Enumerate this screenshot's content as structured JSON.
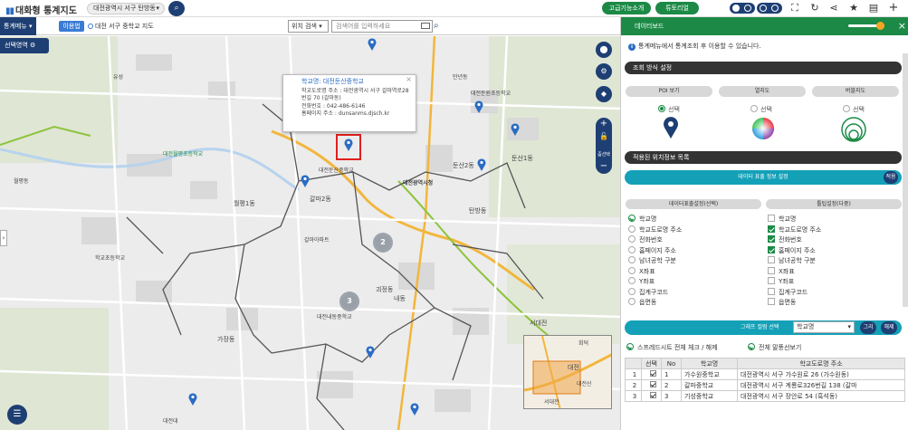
{
  "app": {
    "title": "대화형 통계지도",
    "region": "대전광역시 서구 탄방동"
  },
  "topbar": {
    "advanced": "고급기능소개",
    "tutorial": "튜토리얼"
  },
  "subbar": {
    "menu": "통계메뉴",
    "help": "이용법",
    "breadcrumb": "대전 서구 중학교 지도",
    "search_type": "위치 검색",
    "search_placeholder": "검색어를 입력하세요"
  },
  "map": {
    "select_area": "선택영역",
    "ctrl_labels": {
      "school": "지도",
      "settings": "설정",
      "zoom": "줌선택"
    },
    "popup": {
      "title": "학교명: 대전둔산중학교",
      "lines": [
        "학교도로명 주소 : 대전광역시 서구 갈마역로28번길 70 (갈마동)",
        "전화번호 : 042-486-6146",
        "홈페이지 주소 : dunsanms.djsch.kr"
      ]
    },
    "clusters": [
      "2",
      "3"
    ],
    "labels": [
      "유성",
      "대전월평초등학교",
      "갈마2동",
      "둔산2동",
      "대전광역시청",
      "탄방동",
      "둔산1동",
      "대전둔산중학교",
      "갈마아파트",
      "월평1동",
      "내동",
      "가장동",
      "대전내동중학교",
      "서대전",
      "대전대",
      "학교초등학교",
      "괴정동",
      "만년동",
      "월평동",
      "대전둔원초등학교"
    ],
    "minimap": [
      "회덕",
      "대전",
      "대전신",
      "서대전"
    ]
  },
  "panel": {
    "title": "데이터보드",
    "info": "통계메뉴에서 통계조회 후 이용할 수 있습니다.",
    "sec1": "조회 방식 설정",
    "modes": [
      "POI 보기",
      "열지도",
      "버블지도"
    ],
    "mode_labels": [
      "선택",
      "선택",
      "선택"
    ],
    "sec2": "적용된 위치정보 목록",
    "data_display": "데이터 표출 정보 설정",
    "apply": "적용",
    "subtabs": [
      "데이터표출설정(선택)",
      "툴팁설정(다중)"
    ],
    "left_fields": [
      "학교명",
      "학교도로명 주소",
      "전화번호",
      "홈페이지 주소",
      "남녀공학 구분",
      "X좌표",
      "Y좌표",
      "집계구코드",
      "읍면동"
    ],
    "right_fields": [
      "학교명",
      "학교도로명 주소",
      "전화번호",
      "홈페이지 주소",
      "남녀공학 구분",
      "X좌표",
      "Y좌표",
      "집계구코드",
      "읍면동"
    ],
    "left_checked": [
      true,
      false,
      false,
      false,
      false,
      false,
      false,
      false,
      false
    ],
    "right_checked": [
      false,
      true,
      true,
      true,
      false,
      false,
      false,
      false,
      false
    ],
    "graph_label": "그래프 컬럼 선택",
    "graph_select": "학교명",
    "graph_btn1": "그리",
    "graph_btn2": "해제",
    "check_all": "스프레드시트 전체 체크 / 해제",
    "check_legend": "전체 말풍선보기",
    "table": {
      "headers": [
        "선택",
        "No",
        "학교명",
        "학교도로명 주소"
      ],
      "rows": [
        [
          "1",
          "가수원중학교",
          "대전광역시 서구 가수원로 26 (가수원동)"
        ],
        [
          "2",
          "갈마중학교",
          "대전광역시 서구 계룡로326번길 138 (갈마"
        ],
        [
          "3",
          "기성중학교",
          "대전광역시 서구 장안로 54 (흑석동)"
        ]
      ]
    }
  }
}
